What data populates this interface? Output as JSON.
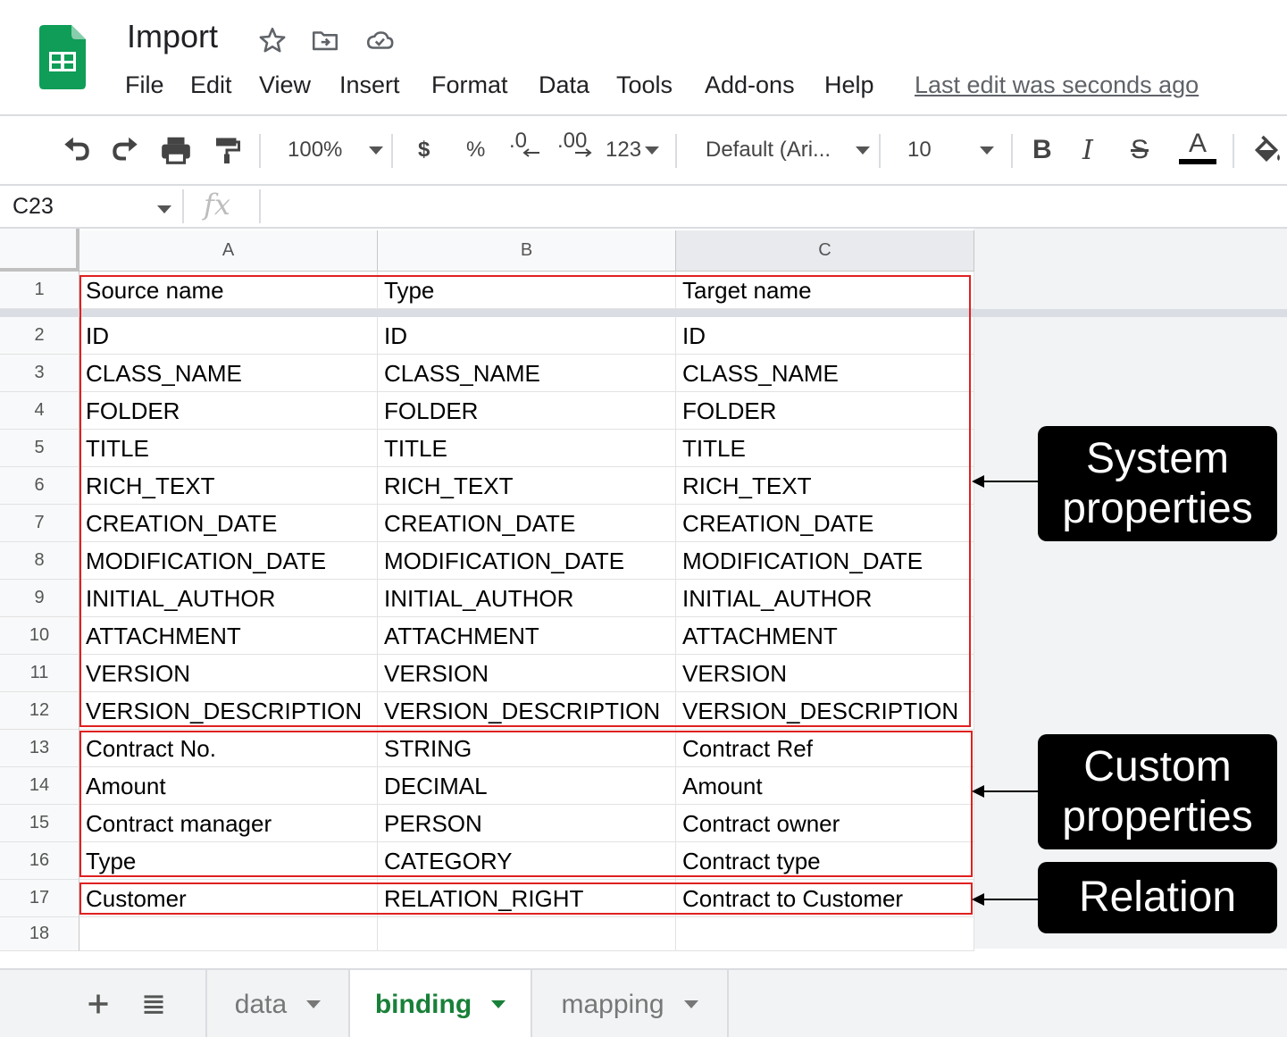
{
  "app": {
    "doc_title": "Import",
    "last_edit": "Last edit was seconds ago"
  },
  "menu": [
    "File",
    "Edit",
    "View",
    "Insert",
    "Format",
    "Data",
    "Tools",
    "Add-ons",
    "Help"
  ],
  "toolbar": {
    "zoom": "100%",
    "currency": "$",
    "percent": "%",
    "decrease_decimal": ".0",
    "increase_decimal": ".00",
    "more_formats": "123",
    "font": "Default (Ari...",
    "font_size": "10",
    "bold": "B",
    "italic": "I",
    "strikethrough": "S",
    "text_color": "A"
  },
  "formula_bar": {
    "cell_ref": "C23",
    "fx": "fx"
  },
  "grid": {
    "columns": [
      "A",
      "B",
      "C"
    ],
    "row_numbers": [
      "1",
      "2",
      "3",
      "4",
      "5",
      "6",
      "7",
      "8",
      "9",
      "10",
      "11",
      "12",
      "13",
      "14",
      "15",
      "16",
      "17",
      "18"
    ],
    "rows": [
      [
        "Source name",
        "Type",
        "Target name"
      ],
      [
        "ID",
        "ID",
        "ID"
      ],
      [
        "CLASS_NAME",
        "CLASS_NAME",
        "CLASS_NAME"
      ],
      [
        "FOLDER",
        "FOLDER",
        "FOLDER"
      ],
      [
        "TITLE",
        "TITLE",
        "TITLE"
      ],
      [
        "RICH_TEXT",
        "RICH_TEXT",
        "RICH_TEXT"
      ],
      [
        "CREATION_DATE",
        "CREATION_DATE",
        "CREATION_DATE"
      ],
      [
        "MODIFICATION_DATE",
        "MODIFICATION_DATE",
        "MODIFICATION_DATE"
      ],
      [
        "INITIAL_AUTHOR",
        "INITIAL_AUTHOR",
        "INITIAL_AUTHOR"
      ],
      [
        "ATTACHMENT",
        "ATTACHMENT",
        "ATTACHMENT"
      ],
      [
        "VERSION",
        "VERSION",
        "VERSION"
      ],
      [
        "VERSION_DESCRIPTION",
        "VERSION_DESCRIPTION",
        "VERSION_DESCRIPTION"
      ],
      [
        "Contract No.",
        "STRING",
        "Contract Ref"
      ],
      [
        "Amount",
        "DECIMAL",
        "Amount"
      ],
      [
        "Contract manager",
        "PERSON",
        "Contract owner"
      ],
      [
        "Type",
        "CATEGORY",
        "Contract type"
      ],
      [
        "Customer",
        "RELATION_RIGHT",
        "Contract to Customer"
      ],
      [
        "",
        "",
        ""
      ]
    ]
  },
  "callouts": {
    "system": [
      "System",
      "properties"
    ],
    "custom": [
      "Custom",
      "properties"
    ],
    "relation": [
      "Relation"
    ]
  },
  "sheet_tabs": [
    {
      "label": "data",
      "active": false
    },
    {
      "label": "binding",
      "active": true
    },
    {
      "label": "mapping",
      "active": false
    }
  ],
  "colors": {
    "logo_green": "#0f9d58",
    "active_tab": "#188038",
    "group_box": "#e02020"
  }
}
